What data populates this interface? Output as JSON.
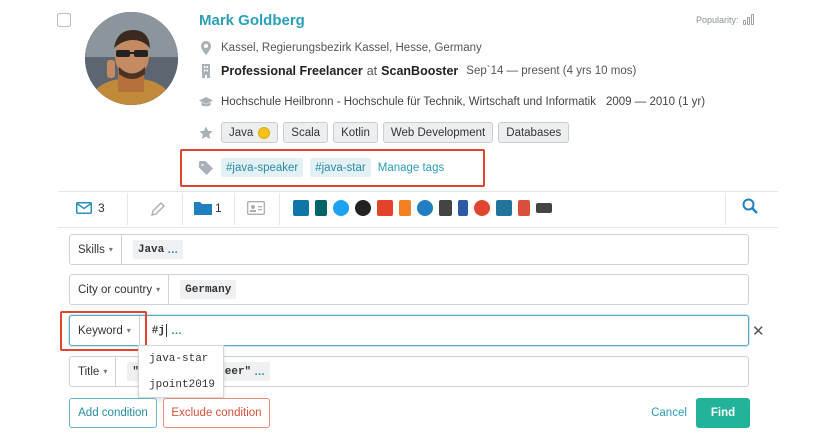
{
  "profile": {
    "name": "Mark Goldberg",
    "popularity_label": "Popularity:",
    "location": "Kassel, Regierungsbezirk Kassel, Hesse, Germany",
    "job": {
      "title": "Professional Freelancer",
      "at": "at",
      "company": "ScanBooster",
      "dates": "Sep`14 — present  (4 yrs 10 mos)"
    },
    "education": {
      "school": "Hochschule Heilbronn - Hochschule für Technik, Wirtschaft und Informatik",
      "dates": "2009 — 2010  (1 yr)"
    },
    "skills": [
      "Java",
      "Scala",
      "Kotlin",
      "Web Development",
      "Databases"
    ],
    "tags": [
      "#java-speaker",
      "#java-star"
    ],
    "manage_tags_label": "Manage tags"
  },
  "toolbar": {
    "messages_count": "3",
    "folders_count": "1",
    "icons": [
      "mail-icon",
      "pencil-icon",
      "folder-icon",
      "contact-card-icon",
      "search-zoom-icon"
    ],
    "social_icons": [
      {
        "name": "linkedin-icon",
        "color": "#0e76a8"
      },
      {
        "name": "xing-icon",
        "color": "#026466"
      },
      {
        "name": "twitter-icon",
        "color": "#1da1f2"
      },
      {
        "name": "github-icon",
        "color": "#222222"
      },
      {
        "name": "gitlab-icon",
        "color": "#e24329"
      },
      {
        "name": "stackoverflow-icon",
        "color": "#f48024"
      },
      {
        "name": "power-icon",
        "color": "#1f7fc1"
      },
      {
        "name": "bars-icon",
        "color": "#444444"
      },
      {
        "name": "bitbucket-icon",
        "color": "#2a5aa8"
      },
      {
        "name": "red-round-icon",
        "color": "#e2452f"
      },
      {
        "name": "wordpress-icon",
        "color": "#21759b"
      },
      {
        "name": "bookmark-icon",
        "color": "#d9503a"
      },
      {
        "name": "link-icon",
        "color": "#444444"
      }
    ]
  },
  "filters": [
    {
      "label": "Skills",
      "value": "Java"
    },
    {
      "label": "City or country",
      "value": "Germany"
    },
    {
      "label": "Keyword",
      "value": "#j"
    },
    {
      "label": "Title",
      "value": "\"s           neer\""
    }
  ],
  "autocomplete": [
    "java-star",
    "jpoint2019"
  ],
  "buttons": {
    "add_condition": "Add condition",
    "exclude_condition": "Exclude condition",
    "cancel": "Cancel",
    "find": "Find"
  },
  "more_glyph": "…",
  "clear_glyph": "✕",
  "caret_glyph": "▾",
  "colors": {
    "accent": "#2aa0b8",
    "highlight_box": "#e1452f",
    "find_button": "#22b39a"
  }
}
